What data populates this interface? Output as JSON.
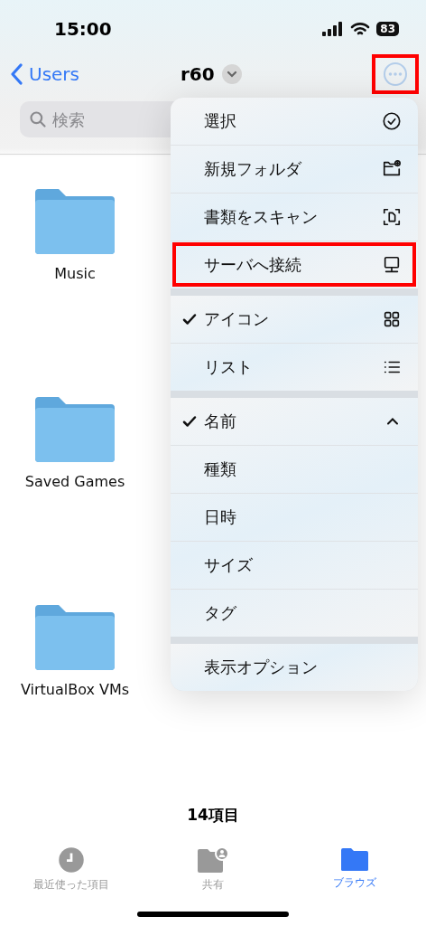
{
  "status_bar": {
    "time": "15:00",
    "battery": "83"
  },
  "nav": {
    "back": "Users",
    "title": "r60",
    "more_highlighted": true
  },
  "search": {
    "placeholder": "検索"
  },
  "folders": [
    {
      "name": "Music"
    },
    {
      "name": "Saved Games"
    },
    {
      "name": "VirtualBox VMs"
    }
  ],
  "menu": {
    "sections": [
      {
        "items": [
          {
            "label": "選択",
            "highlighted": false
          },
          {
            "label": "新規フォルダ",
            "highlighted": false
          },
          {
            "label": "書類をスキャン",
            "highlighted": false
          },
          {
            "label": "サーバへ接続",
            "highlighted": true
          }
        ]
      },
      {
        "items": [
          {
            "label": "アイコン",
            "checked": true
          },
          {
            "label": "リスト",
            "checked": false
          }
        ]
      },
      {
        "items": [
          {
            "label": "名前",
            "checked": true
          },
          {
            "label": "種類",
            "checked": false
          },
          {
            "label": "日時",
            "checked": false
          },
          {
            "label": "サイズ",
            "checked": false
          },
          {
            "label": "タグ",
            "checked": false
          }
        ]
      },
      {
        "items": [
          {
            "label": "表示オプション"
          }
        ]
      }
    ]
  },
  "item_count": "14項目",
  "tabs": [
    {
      "label": "最近使った項目",
      "selected": false
    },
    {
      "label": "共有",
      "selected": false
    },
    {
      "label": "ブラウズ",
      "selected": true
    }
  ]
}
